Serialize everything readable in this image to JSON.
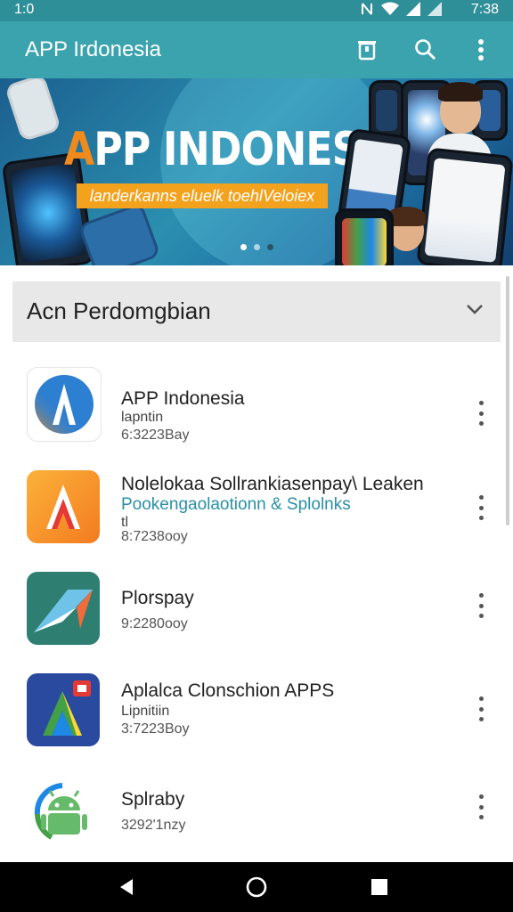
{
  "status_bar": {
    "time_left": "1:0",
    "time_right": "7:38"
  },
  "app_bar": {
    "title": "APP Irdonesia"
  },
  "banner": {
    "title_first": "A",
    "title_rest": "PP INDONESIA",
    "tagline": "landerkanns eluelk toehlVeloiex"
  },
  "section": {
    "title": "Acn Perdomgbian"
  },
  "apps": [
    {
      "name": "APP Indonesia",
      "sub": "lapntin",
      "meta": "6:3223Bay"
    },
    {
      "name": "Nolelokaa Sollrankiasenpay\\ Leaken",
      "link": "Pookengaolaotionn & Splolnks",
      "sub": "tl",
      "meta": "8:7238ooy"
    },
    {
      "name": "Plorspay",
      "meta": "9:2280ooy"
    },
    {
      "name": "Aplalca Clonschion APPS",
      "sub": "Lipnitiin",
      "meta": "3:7223Boy"
    },
    {
      "name": "Splraby",
      "meta": "3292'1nzy"
    }
  ],
  "colors": {
    "statusbar": "#2f8f98",
    "appbar": "#3aa3ad",
    "accent_orange": "#f2a21d",
    "link": "#2a8fa6"
  }
}
